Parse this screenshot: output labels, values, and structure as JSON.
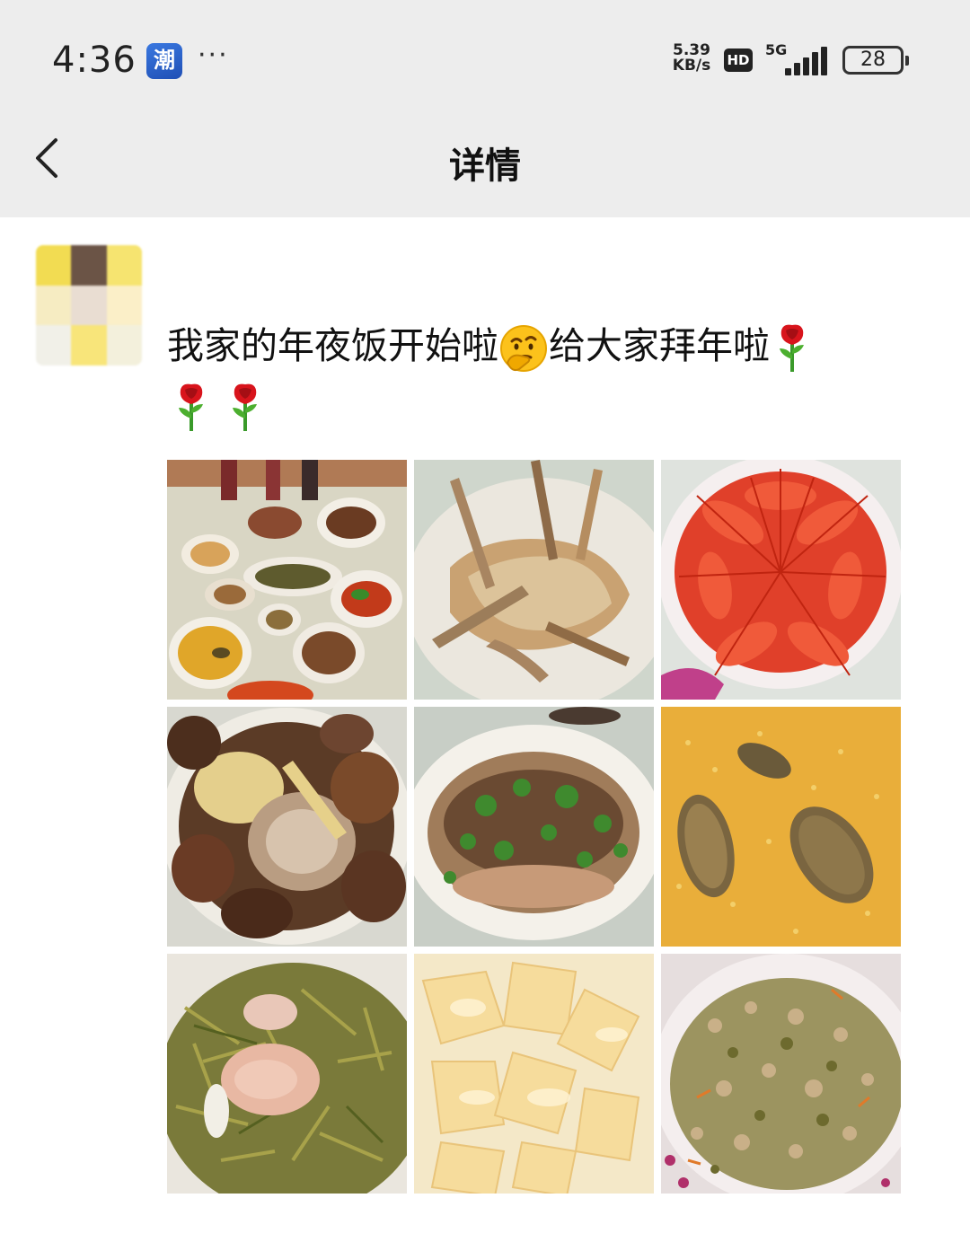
{
  "status_bar": {
    "time": "4:36",
    "app_icon_glyph": "潮",
    "more_dots": "···",
    "net_speed_value": "5.39",
    "net_speed_unit": "KB/s",
    "hd_badge": "HD",
    "network_type": "5G",
    "battery": "28"
  },
  "nav": {
    "title": "详情",
    "back_icon": "chevron-left-icon"
  },
  "post": {
    "text_main": "我家的年夜饭开始啦",
    "text_after_emoji": "给大家拜年啦",
    "emoji": "thinking-face-emoji",
    "rose_icon": "rose-icon",
    "photos": [
      {
        "name": "photo-table-spread"
      },
      {
        "name": "photo-fried-fish"
      },
      {
        "name": "photo-red-shrimp"
      },
      {
        "name": "photo-braised-chicken"
      },
      {
        "name": "photo-steamed-fish"
      },
      {
        "name": "photo-abalone-millet"
      },
      {
        "name": "photo-pickled-greens"
      },
      {
        "name": "photo-tofu-skin"
      },
      {
        "name": "photo-minced-stirfry"
      }
    ]
  },
  "colors": {
    "header_bg": "#ededed",
    "page_bg": "#ffffff",
    "text": "#111111"
  }
}
